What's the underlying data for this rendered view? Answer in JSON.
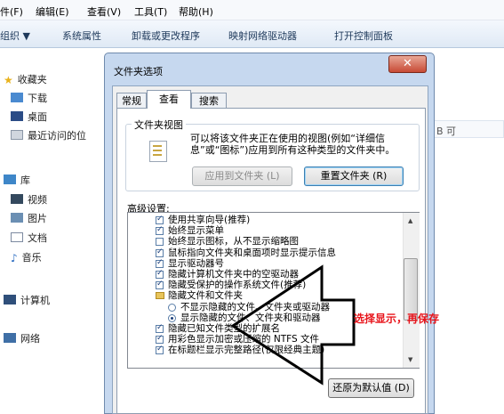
{
  "menubar": {
    "file": "件(F)",
    "edit": "编辑(E)",
    "view": "查看(V)",
    "tools": "工具(T)",
    "help": "帮助(H)"
  },
  "toolbar": {
    "organize": "组织 ▼",
    "sysprops": "系统属性",
    "uninstall": "卸载或更改程序",
    "mapdrive": "映射网络驱动器",
    "controlpanel": "打开控制面板"
  },
  "nav": {
    "favorites": "收藏夹",
    "downloads": "下载",
    "desktop": "桌面",
    "recent": "最近访问的位",
    "libraries": "库",
    "videos": "视频",
    "pictures": "图片",
    "documents": "文档",
    "music": "音乐",
    "computer": "计算机",
    "network": "网络"
  },
  "rightpane": {
    "column_text": "B 可"
  },
  "dialog": {
    "title": "文件夹选项",
    "tabs": [
      "常规",
      "查看",
      "搜索"
    ],
    "folder_views_label": "文件夹视图",
    "folder_views_text": "可以将该文件夹正在使用的视图(例如“详细信息”或“图标”)应用到所有这种类型的文件夹中。",
    "apply_button": "应用到文件夹 (L)",
    "reset_button": "重置文件夹 (R)",
    "advanced_label": "高级设置:",
    "advanced": [
      {
        "label": "使用共享向导(推荐)",
        "kind": "checkbox",
        "checked": true
      },
      {
        "label": "始终显示菜单",
        "kind": "checkbox",
        "checked": true
      },
      {
        "label": "始终显示图标，从不显示缩略图",
        "kind": "checkbox",
        "checked": false
      },
      {
        "label": "鼠标指向文件夹和桌面项时显示提示信息",
        "kind": "checkbox",
        "checked": true
      },
      {
        "label": "显示驱动器号",
        "kind": "checkbox",
        "checked": true
      },
      {
        "label": "隐藏计算机文件夹中的空驱动器",
        "kind": "checkbox",
        "checked": true
      },
      {
        "label": "隐藏受保护的操作系统文件(推荐)",
        "kind": "checkbox",
        "checked": true
      },
      {
        "label": "隐藏文件和文件夹",
        "kind": "folder",
        "checked": false
      },
      {
        "label": "不显示隐藏的文件、文件夹或驱动器",
        "kind": "radio",
        "checked": false
      },
      {
        "label": "显示隐藏的文件、文件夹和驱动器",
        "kind": "radio",
        "checked": true
      },
      {
        "label": "隐藏已知文件类型的扩展名",
        "kind": "checkbox",
        "checked": true
      },
      {
        "label": "用彩色显示加密或压缩的 NTFS 文件",
        "kind": "checkbox",
        "checked": true
      },
      {
        "label": "在标题栏显示完整路径(仅限经典主题)",
        "kind": "checkbox",
        "checked": true
      }
    ],
    "default_button": "还原为默认值 (D)"
  },
  "annotation": "选择显示，再保存",
  "colors": {
    "annotation": "#e8141b",
    "arrow_outline": "#000000"
  }
}
